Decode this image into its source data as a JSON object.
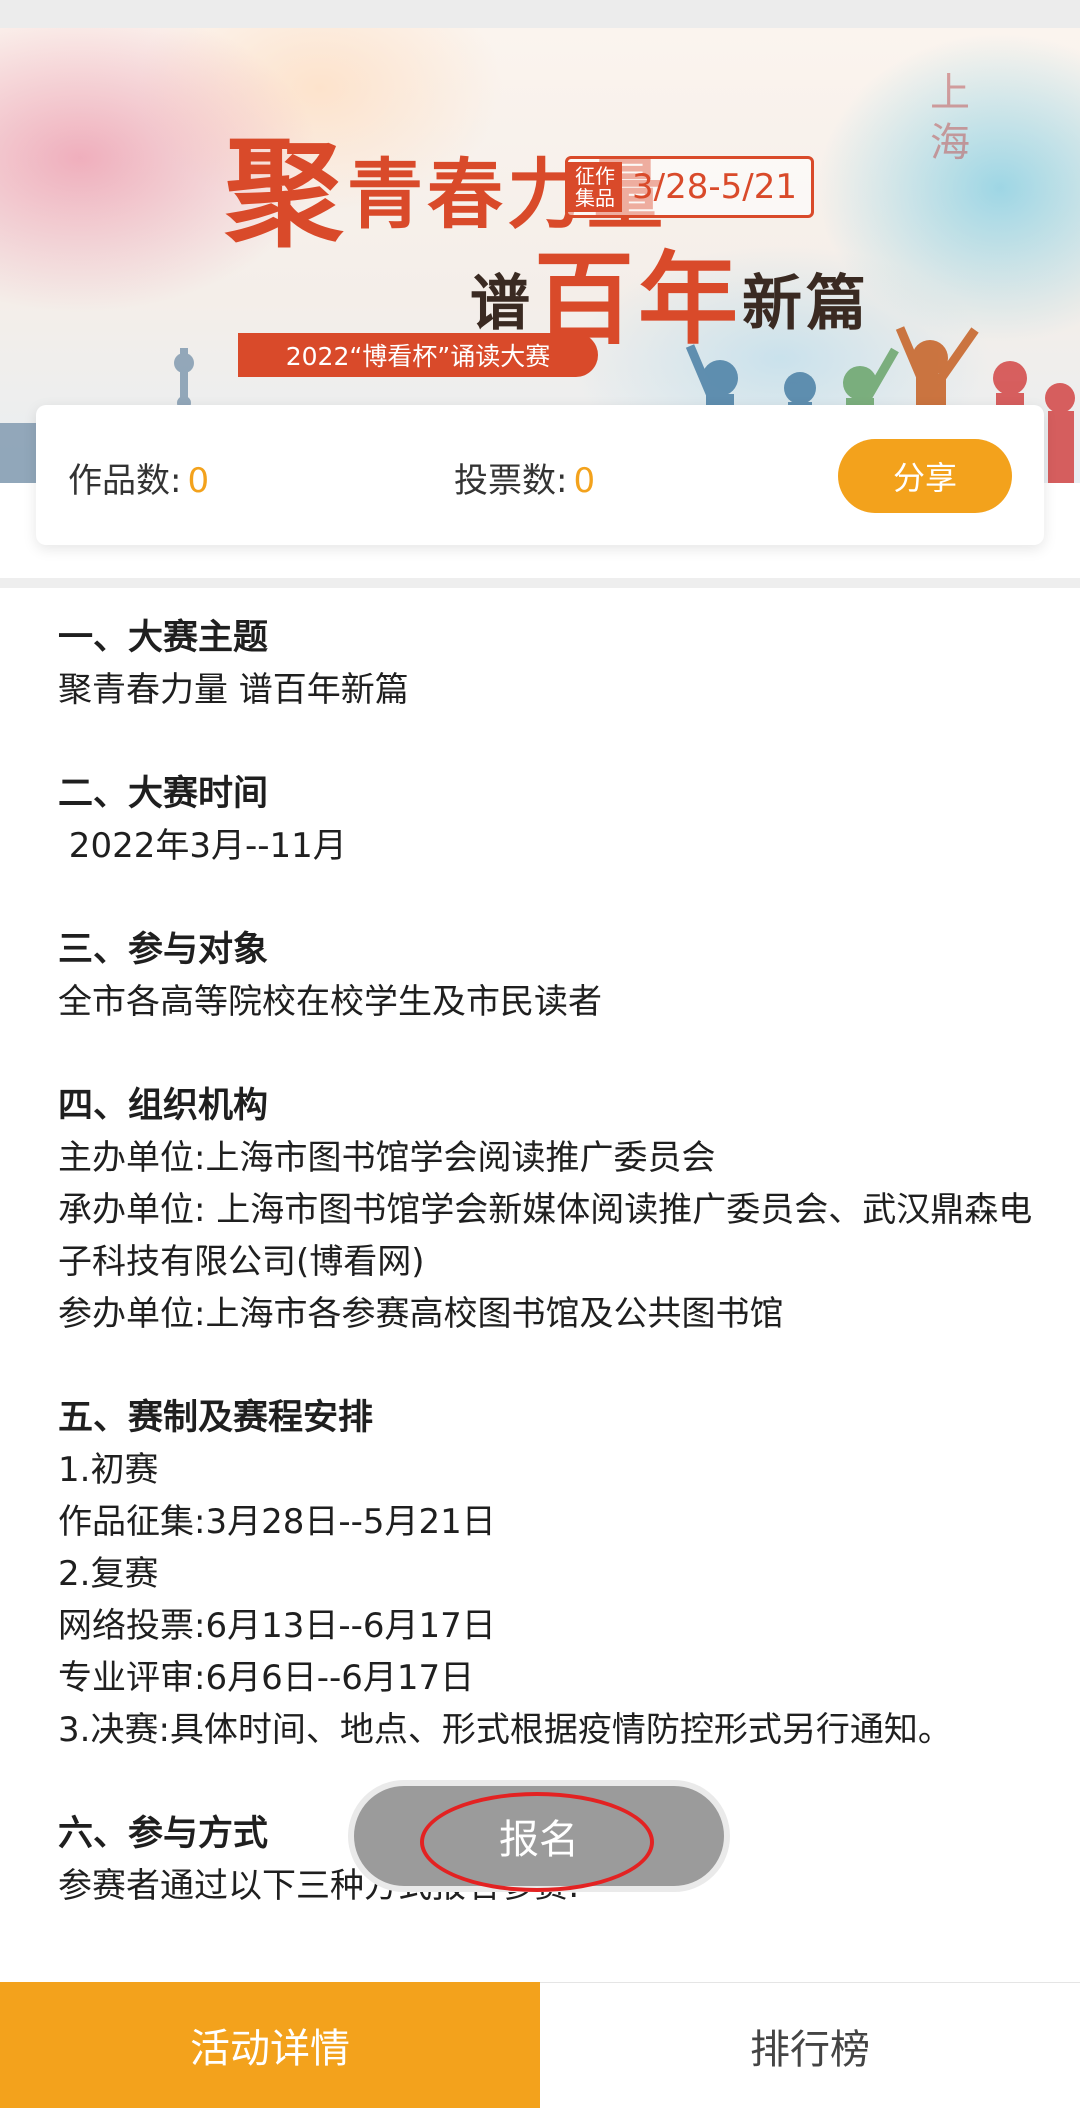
{
  "banner": {
    "title_first": "聚",
    "title_rest": "青春力量",
    "title2_first": "谱",
    "title2_big": "百年",
    "title2_rest": "新篇",
    "date_tag": "征作集品",
    "date_range": "3/28-5/21",
    "subtitle": "2022“博看杯”诵读大赛",
    "corner_text": "上海"
  },
  "stats": {
    "works_label": "作品数:",
    "works_value": "0",
    "votes_label": "投票数:",
    "votes_value": "0",
    "share_label": "分享"
  },
  "sections": [
    {
      "heading": "一、大赛主题",
      "lines": [
        "聚青春力量 谱百年新篇"
      ]
    },
    {
      "heading": "二、大赛时间",
      "lines": [
        " 2022年3月--11月"
      ]
    },
    {
      "heading": "三、参与对象",
      "lines": [
        "全市各高等院校在校学生及市民读者"
      ]
    },
    {
      "heading": "四、组织机构",
      "lines": [
        "主办单位:上海市图书馆学会阅读推广委员会",
        "承办单位: 上海市图书馆学会新媒体阅读推广委员会、武汉鼎森电子科技有限公司(博看网)",
        "参办单位:上海市各参赛高校图书馆及公共图书馆"
      ]
    },
    {
      "heading": "五、赛制及赛程安排",
      "lines": [
        "1.初赛",
        "作品征集:3月28日--5月21日",
        "2.复赛",
        "网络投票:6月13日--6月17日",
        "专业评审:6月6日--6月17日",
        "3.决赛:具体时间、地点、形式根据疫情防控形式另行通知。"
      ]
    },
    {
      "heading": "六、参与方式",
      "lines": [
        "参赛者通过以下三种方式报名参赛:"
      ]
    }
  ],
  "register_button": "报名",
  "tabs": {
    "details": "活动详情",
    "ranking": "排行榜"
  },
  "colors": {
    "accent": "#f3a21c",
    "banner_red": "#d94a2a",
    "highlight": "#e32222"
  }
}
